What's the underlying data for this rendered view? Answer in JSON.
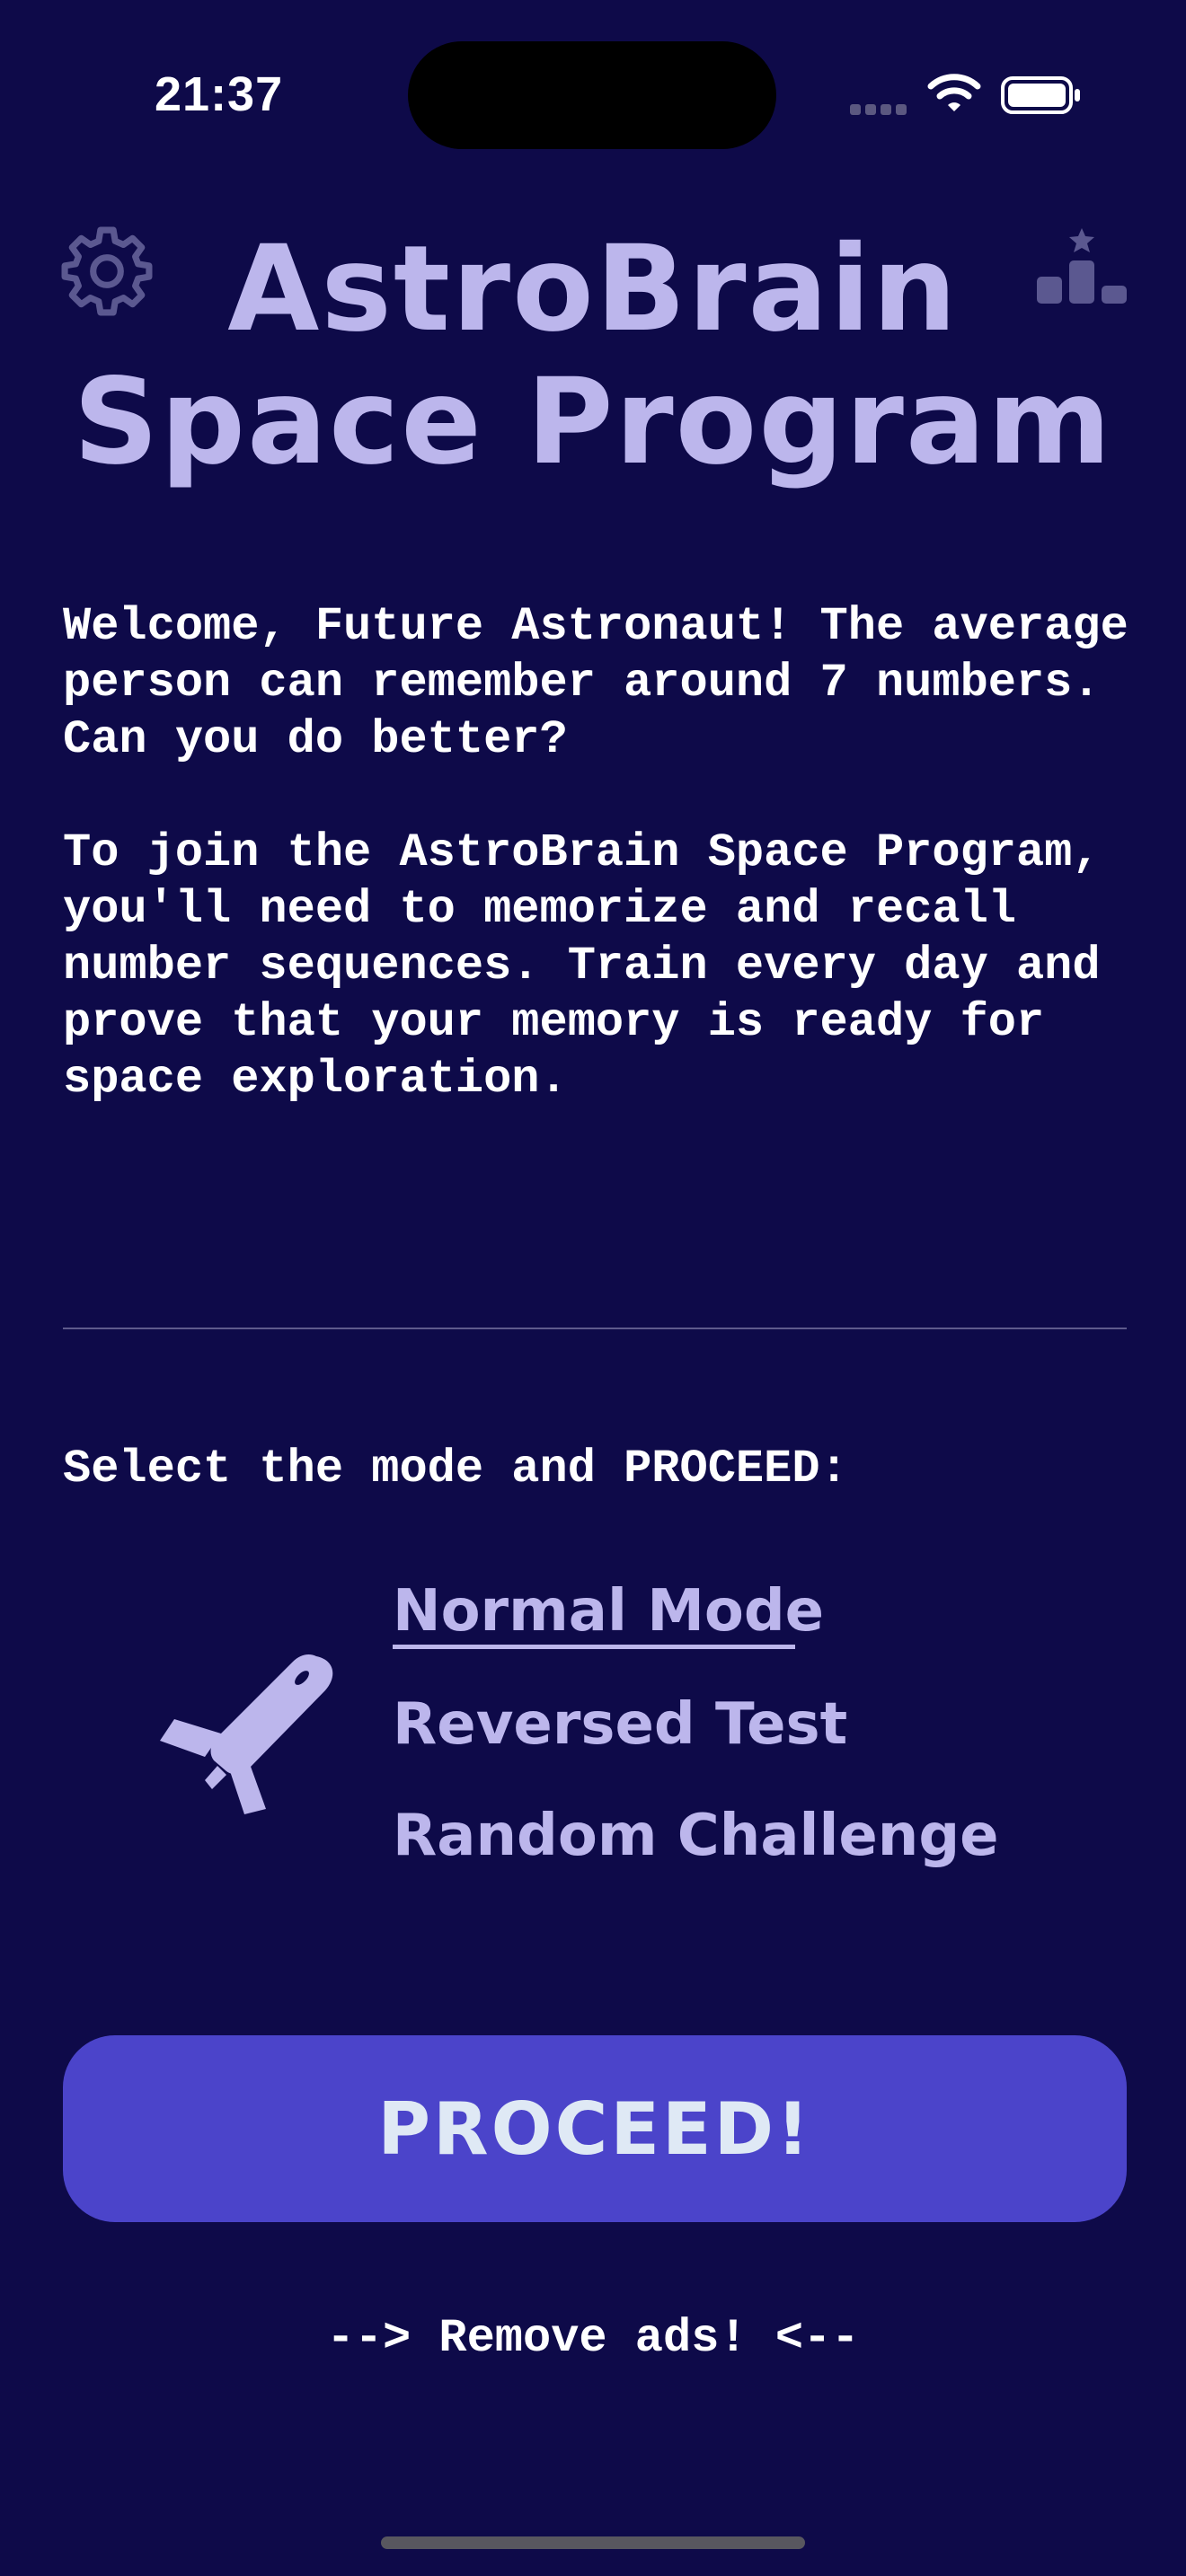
{
  "status_bar": {
    "time": "21:37",
    "icons": [
      "cellular-signal-icon",
      "wifi-icon",
      "battery-icon"
    ]
  },
  "header": {
    "settings_icon": "gear-icon",
    "leaderboard_icon": "leaderboard-podium-icon",
    "title_line1": "AstroBrain",
    "title_line2": "Space Program"
  },
  "intro": {
    "paragraph1": "Welcome, Future Astronaut! The average person can remember around 7 numbers. Can you do better?",
    "paragraph2": "To join the AstroBrain Space Program, you'll need to memorize and recall number sequences. Train every day and prove that your memory is ready for space exploration."
  },
  "mode_select": {
    "label": "Select the mode and PROCEED:",
    "icon": "space-shuttle-icon",
    "options": [
      {
        "label": "Normal Mode",
        "selected": true
      },
      {
        "label": "Reversed Test",
        "selected": false
      },
      {
        "label": "Random Challenge",
        "selected": false
      }
    ]
  },
  "proceed_button": {
    "label": "PROCEED!"
  },
  "remove_ads": {
    "label": "--> Remove ads! <--"
  },
  "colors": {
    "background": "#0e0a49",
    "accent_text": "#bcb6ec",
    "button": "#4b44ca",
    "button_text": "#dfe9f5",
    "body_text": "#ffffff"
  }
}
